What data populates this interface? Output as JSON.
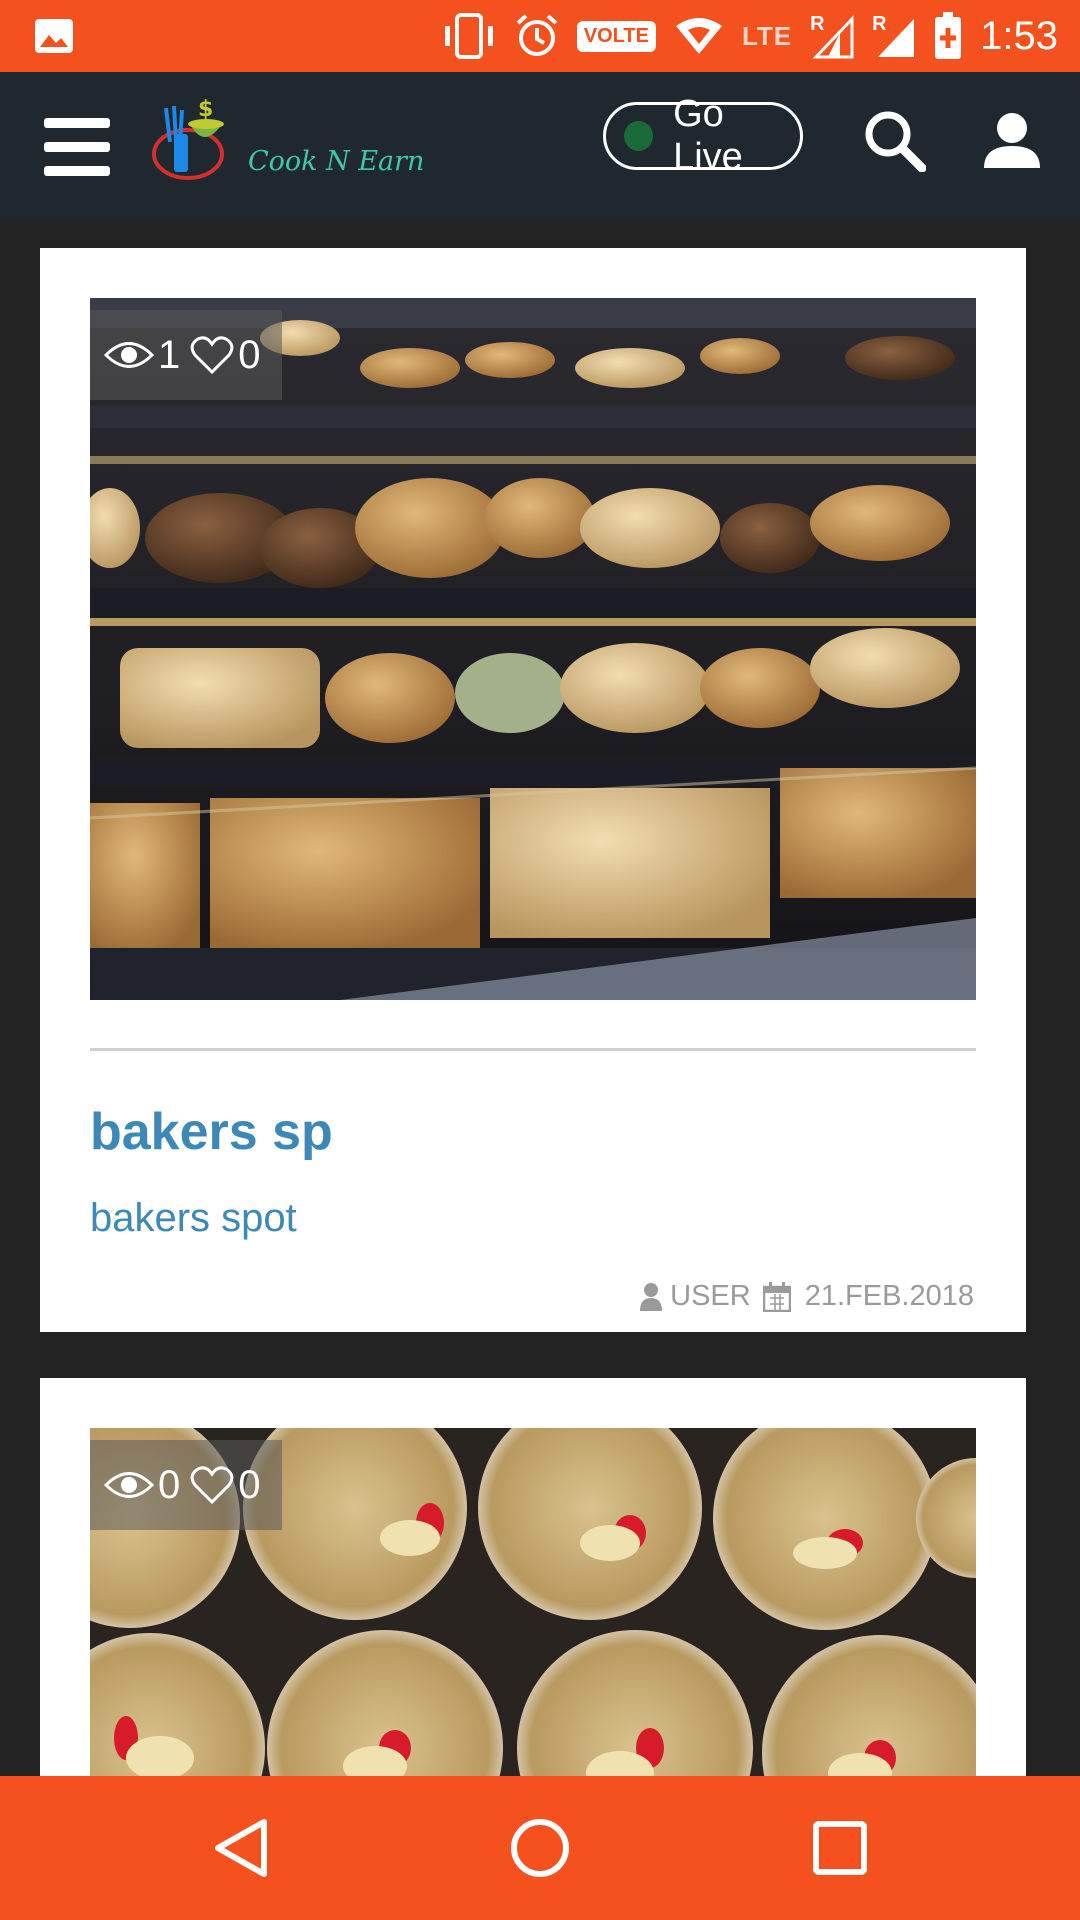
{
  "status_bar": {
    "time": "1:53",
    "volte": "VOLTE",
    "lte": "LTE",
    "roaming_1": "R",
    "roaming_2": "R",
    "icons": [
      "image-icon",
      "vibrate-icon",
      "alarm-icon",
      "wifi-icon",
      "signal-icon",
      "battery-icon"
    ]
  },
  "app_bar": {
    "logo_text": "Cook N Earn",
    "go_live_label": "Go Live",
    "go_live_dot_color": "#1b6b3a",
    "icons": [
      "menu-icon",
      "search-icon",
      "user-icon"
    ]
  },
  "feed": {
    "posts": [
      {
        "views": "1",
        "likes": "0",
        "title": "bakers sp",
        "description": "bakers spot",
        "author": "USER",
        "date": "21.FEB.2018",
        "image": "bakery-display-cookies"
      },
      {
        "views": "0",
        "likes": "0",
        "image": "dessert-cups"
      }
    ]
  },
  "colors": {
    "accent": "#f4511e",
    "app_bar": "#1e282e",
    "link": "#3e88b8",
    "background": "#222223"
  }
}
